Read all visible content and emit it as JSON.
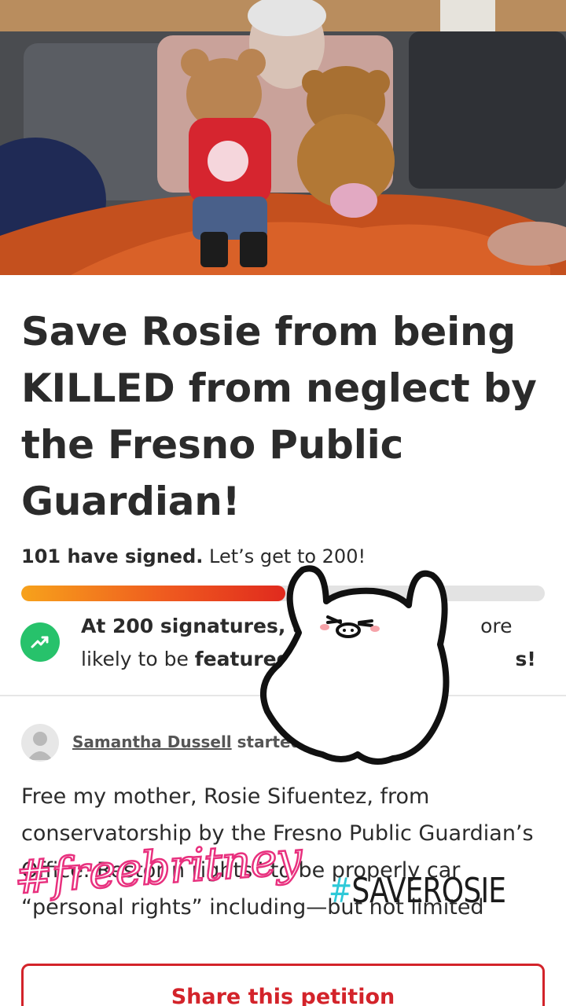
{
  "petition": {
    "title": "Save Rosie from being KILLED from neglect by the Fresno Public Guardian!",
    "signed_count": "101 have signed.",
    "signed_goal_text": "Let’s get to 200!",
    "progress_fraction": 0.505,
    "goal_note": {
      "bold_a": "At 200 signatures,",
      "text_a": " t",
      "text_b": "ore likely to be ",
      "bold_b": "featured in r",
      "text_c": "s!"
    },
    "starter_name": "Samantha Dussell",
    "starter_suffix": "started",
    "body": "Free my mother, Rosie Sifuentez, from conservatorship by the Fresno Public Guardian’s Office. Restor                          n rights” to be properly car “personal rights” including—but not limited",
    "share_label": "Share this petition"
  },
  "stickers": {
    "freebritney": "#freebritney",
    "saverosie_hash": "#",
    "saverosie": "SAVEROSIE"
  },
  "colors": {
    "accent_red": "#d3232a",
    "progress_start": "#f7a21b",
    "progress_end": "#e02a1e",
    "goal_icon": "#27c26b"
  },
  "icons": [
    "trending-up-icon",
    "user-avatar-icon"
  ]
}
